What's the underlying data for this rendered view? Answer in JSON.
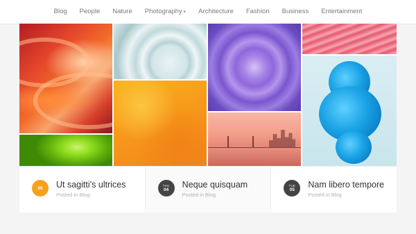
{
  "nav": {
    "items": [
      {
        "label": "Blog"
      },
      {
        "label": "People"
      },
      {
        "label": "Nature"
      },
      {
        "label": "Photography",
        "has_dropdown": true
      },
      {
        "label": "Architecture"
      },
      {
        "label": "Fashion"
      },
      {
        "label": "Business"
      },
      {
        "label": "Entertainment"
      }
    ]
  },
  "posts": [
    {
      "dow": "",
      "day": "05",
      "title": "Ut sagitti’s ultrices",
      "meta": "Posted in Blog",
      "badge_color": "#f6a21b"
    },
    {
      "dow": "THU",
      "day": "04",
      "title": "Neque quisquam",
      "meta": "Posted in Blog",
      "badge_color": "#444444"
    },
    {
      "dow": "TUE",
      "day": "05",
      "title": "Nam libero tempore",
      "meta": "Posted in Blog",
      "badge_color": "#444444"
    }
  ],
  "colors": {
    "accent": "#f6a21b",
    "badge_dark": "#444444",
    "nav_text": "#7a7a7a"
  }
}
